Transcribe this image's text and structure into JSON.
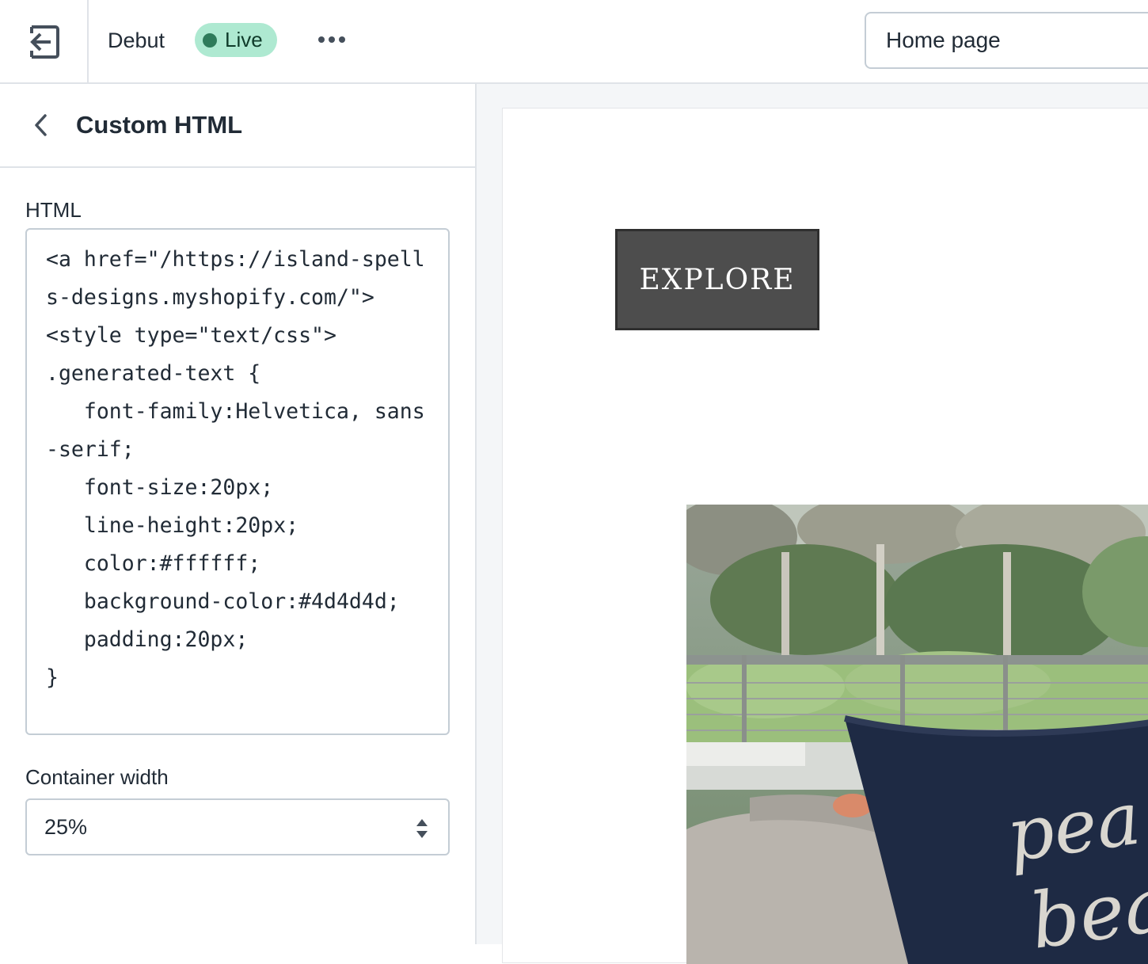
{
  "topbar": {
    "exit_icon": "exit-arrow-icon",
    "theme_name": "Debut",
    "status_badge": "Live",
    "status_color": "#aee9d1",
    "more_icon": "more-horizontal-icon",
    "page_select_value": "Home page"
  },
  "sidebar": {
    "back_icon": "chevron-left-icon",
    "title": "Custom HTML",
    "html_label": "HTML",
    "html_value": "<a href=\"/https://island-spells-designs.myshopify.com/\">\n<style type=\"text/css\">\n.generated-text {\n   font-family:Helvetica, sans-serif;\n   font-size:20px;\n   line-height:20px;\n   color:#ffffff;\n   background-color:#4d4d4d;\n   padding:20px;\n}",
    "container_width_label": "Container width",
    "container_width_value": "25%",
    "stepper_icon": "select-stepper-icon"
  },
  "preview": {
    "button_label": "EXPLORE",
    "button_color": "#4d4d4d",
    "image_text": "peace\nbeach"
  }
}
